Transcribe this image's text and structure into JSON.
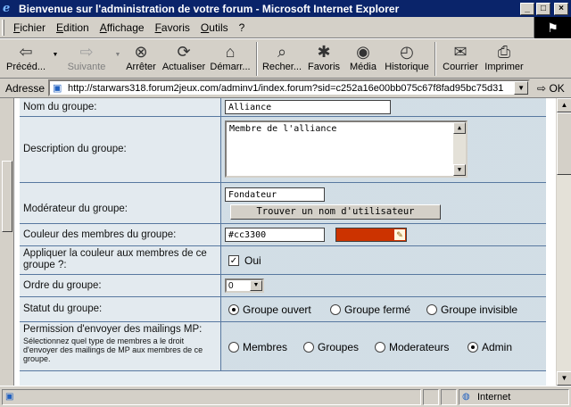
{
  "window": {
    "title": "Bienvenue sur l'administration de votre forum - Microsoft Internet Explorer",
    "controls": {
      "minimize": "_",
      "maximize": "□",
      "close": "×"
    }
  },
  "menu": {
    "items": [
      "Fichier",
      "Edition",
      "Affichage",
      "Favoris",
      "Outils",
      "?"
    ]
  },
  "toolbar": {
    "back": "Précéd...",
    "forward": "Suivante",
    "stop": "Arrêter",
    "refresh": "Actualiser",
    "home": "Démarr...",
    "search": "Recher...",
    "favorites": "Favoris",
    "media": "Média",
    "history": "Historique",
    "mail": "Courrier",
    "print": "Imprimer"
  },
  "address": {
    "label": "Adresse",
    "url": "http://starwars318.forum2jeux.com/adminv1/index.forum?sid=c252a16e00bb075c67f8fad95bc75d31",
    "go": "OK"
  },
  "form": {
    "name_label": "Nom du groupe:",
    "name_value": "Alliance",
    "desc_label": "Description du groupe:",
    "desc_value": "Membre de l'alliance",
    "mod_label": "Modérateur du groupe:",
    "mod_value": "Fondateur",
    "find_user_button": "Trouver un nom d'utilisateur",
    "color_label": "Couleur des membres du groupe:",
    "color_value": "#cc3300",
    "color_hex": "#cc3300",
    "apply_color_label": "Appliquer la couleur aux membres de ce groupe ?:",
    "apply_color_checked": true,
    "apply_color_option": "Oui",
    "order_label": "Ordre du groupe:",
    "order_value": "0",
    "status_label": "Statut du groupe:",
    "status_options": [
      "Groupe ouvert",
      "Groupe fermé",
      "Groupe invisible"
    ],
    "status_selected": "Groupe ouvert",
    "perm_label": "Permission d'envoyer des mailings MP:",
    "perm_help": "Sélectionnez quel type de membres a le droit d'envoyer des mailings de MP aux membres de ce groupe.",
    "perm_options": [
      "Membres",
      "Groupes",
      "Moderateurs",
      "Admin"
    ],
    "perm_selected": "Admin"
  },
  "status": {
    "left": "",
    "zone": "Internet"
  }
}
